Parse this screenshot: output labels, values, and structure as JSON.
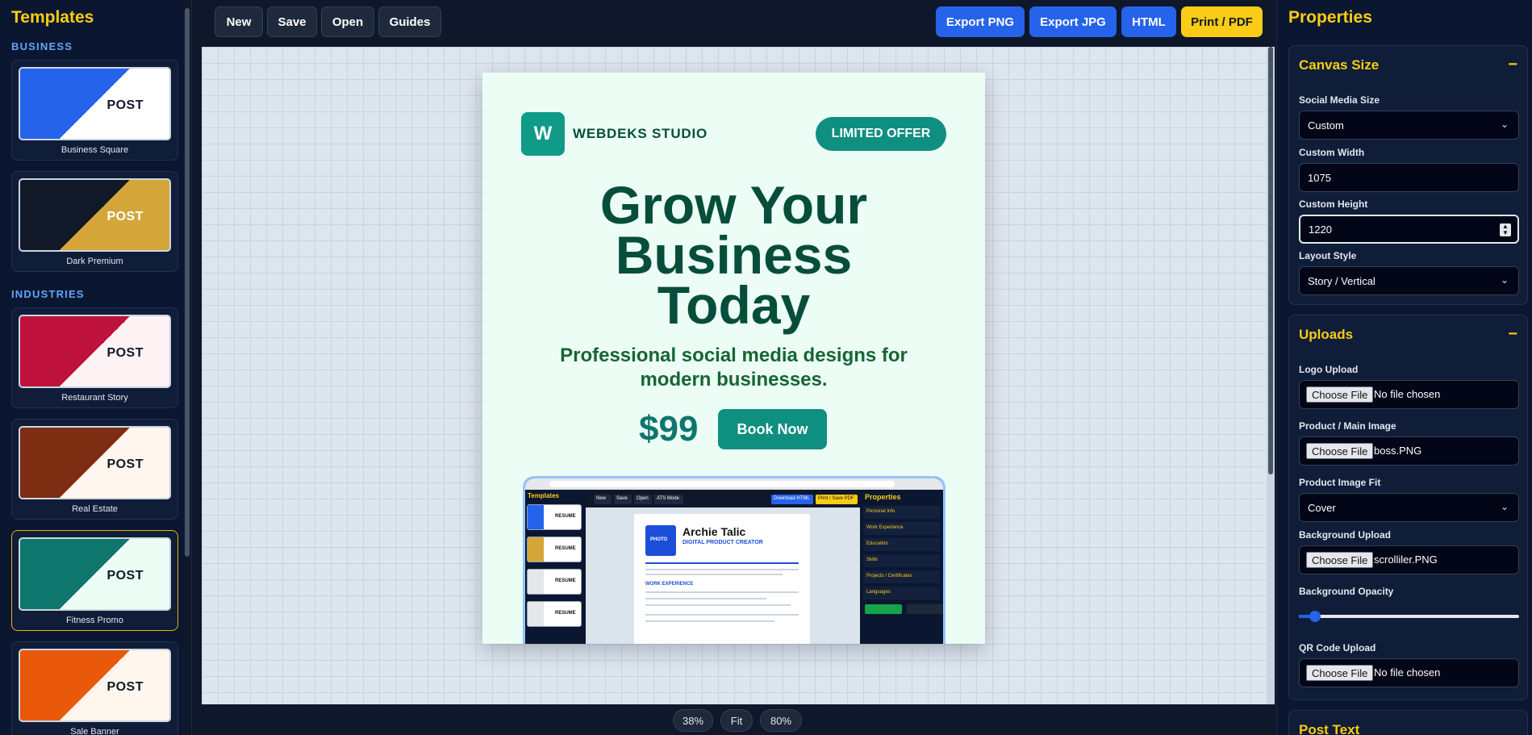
{
  "left_sidebar": {
    "title": "Templates",
    "section_business": "BUSINESS",
    "section_industries": "INDUSTRIES",
    "templates": [
      {
        "name": "Business Square",
        "post": "POST",
        "c1": "#2563eb",
        "c2": "#ffffff"
      },
      {
        "name": "Dark Premium",
        "post": "POST",
        "c1": "#111827",
        "c2": "#d4a63a"
      },
      {
        "name": "Restaurant Story",
        "post": "POST",
        "c1": "#be123c",
        "c2": "#fdf2f4"
      },
      {
        "name": "Real Estate",
        "post": "POST",
        "c1": "#7c2d12",
        "c2": "#fff7ed"
      },
      {
        "name": "Fitness Promo",
        "post": "POST",
        "c1": "#0f766e",
        "c2": "#ecfdf5"
      },
      {
        "name": "Sale Banner",
        "post": "POST",
        "c1": "#ea580c",
        "c2": "#fff7ed"
      }
    ]
  },
  "toolbar": {
    "new": "New",
    "save": "Save",
    "open": "Open",
    "guides": "Guides",
    "export_png": "Export PNG",
    "export_jpg": "Export JPG",
    "html": "HTML",
    "print_pdf": "Print / PDF"
  },
  "poster": {
    "logo_letter": "W",
    "studio": "WEBDEKS STUDIO",
    "offer": "LIMITED OFFER",
    "headline": [
      "Grow Your",
      "Business",
      "Today"
    ],
    "subline": "Professional social media designs for modern businesses.",
    "price": "$99",
    "cta": "Book Now",
    "screenshot": {
      "left_title": "Templates",
      "mini_label": "RESUME",
      "btn_new": "New",
      "btn_save": "Save",
      "btn_open": "Open",
      "btn_ats": "ATS Mode",
      "btn_download": "Download HTML",
      "btn_print": "Print / Save PDF",
      "doc_name": "Archie Talic",
      "doc_role": "DIGITAL PRODUCT CREATOR",
      "photo": "PHOTO",
      "section": "WORK EXPERIENCE",
      "right_title": "Properties",
      "right_rows": [
        "Personal Info",
        "Work Experience",
        "Education",
        "Skills",
        "Projects / Certificates",
        "Languages"
      ]
    }
  },
  "zoom": {
    "z38": "38%",
    "fit": "Fit",
    "z80": "80%"
  },
  "properties": {
    "title": "Properties",
    "canvas": {
      "heading": "Canvas Size",
      "toggle": "−",
      "social_label": "Social Media Size",
      "social_value": "Custom",
      "width_label": "Custom Width",
      "width_value": "1075",
      "height_label": "Custom Height",
      "height_value": "1220",
      "layout_label": "Layout Style",
      "layout_value": "Story / Vertical"
    },
    "uploads": {
      "heading": "Uploads",
      "toggle": "−",
      "logo_label": "Logo Upload",
      "logo_file": "No file chosen",
      "product_label": "Product / Main Image",
      "product_file": "boss.PNG",
      "fit_label": "Product Image Fit",
      "fit_value": "Cover",
      "bg_label": "Background Upload",
      "bg_file": "scrolliler.PNG",
      "opacity_label": "Background Opacity",
      "opacity_value": 0.05,
      "qr_label": "QR Code Upload",
      "qr_file": "No file chosen",
      "choose": "Choose File"
    },
    "post_text": {
      "heading": "Post Text"
    }
  }
}
